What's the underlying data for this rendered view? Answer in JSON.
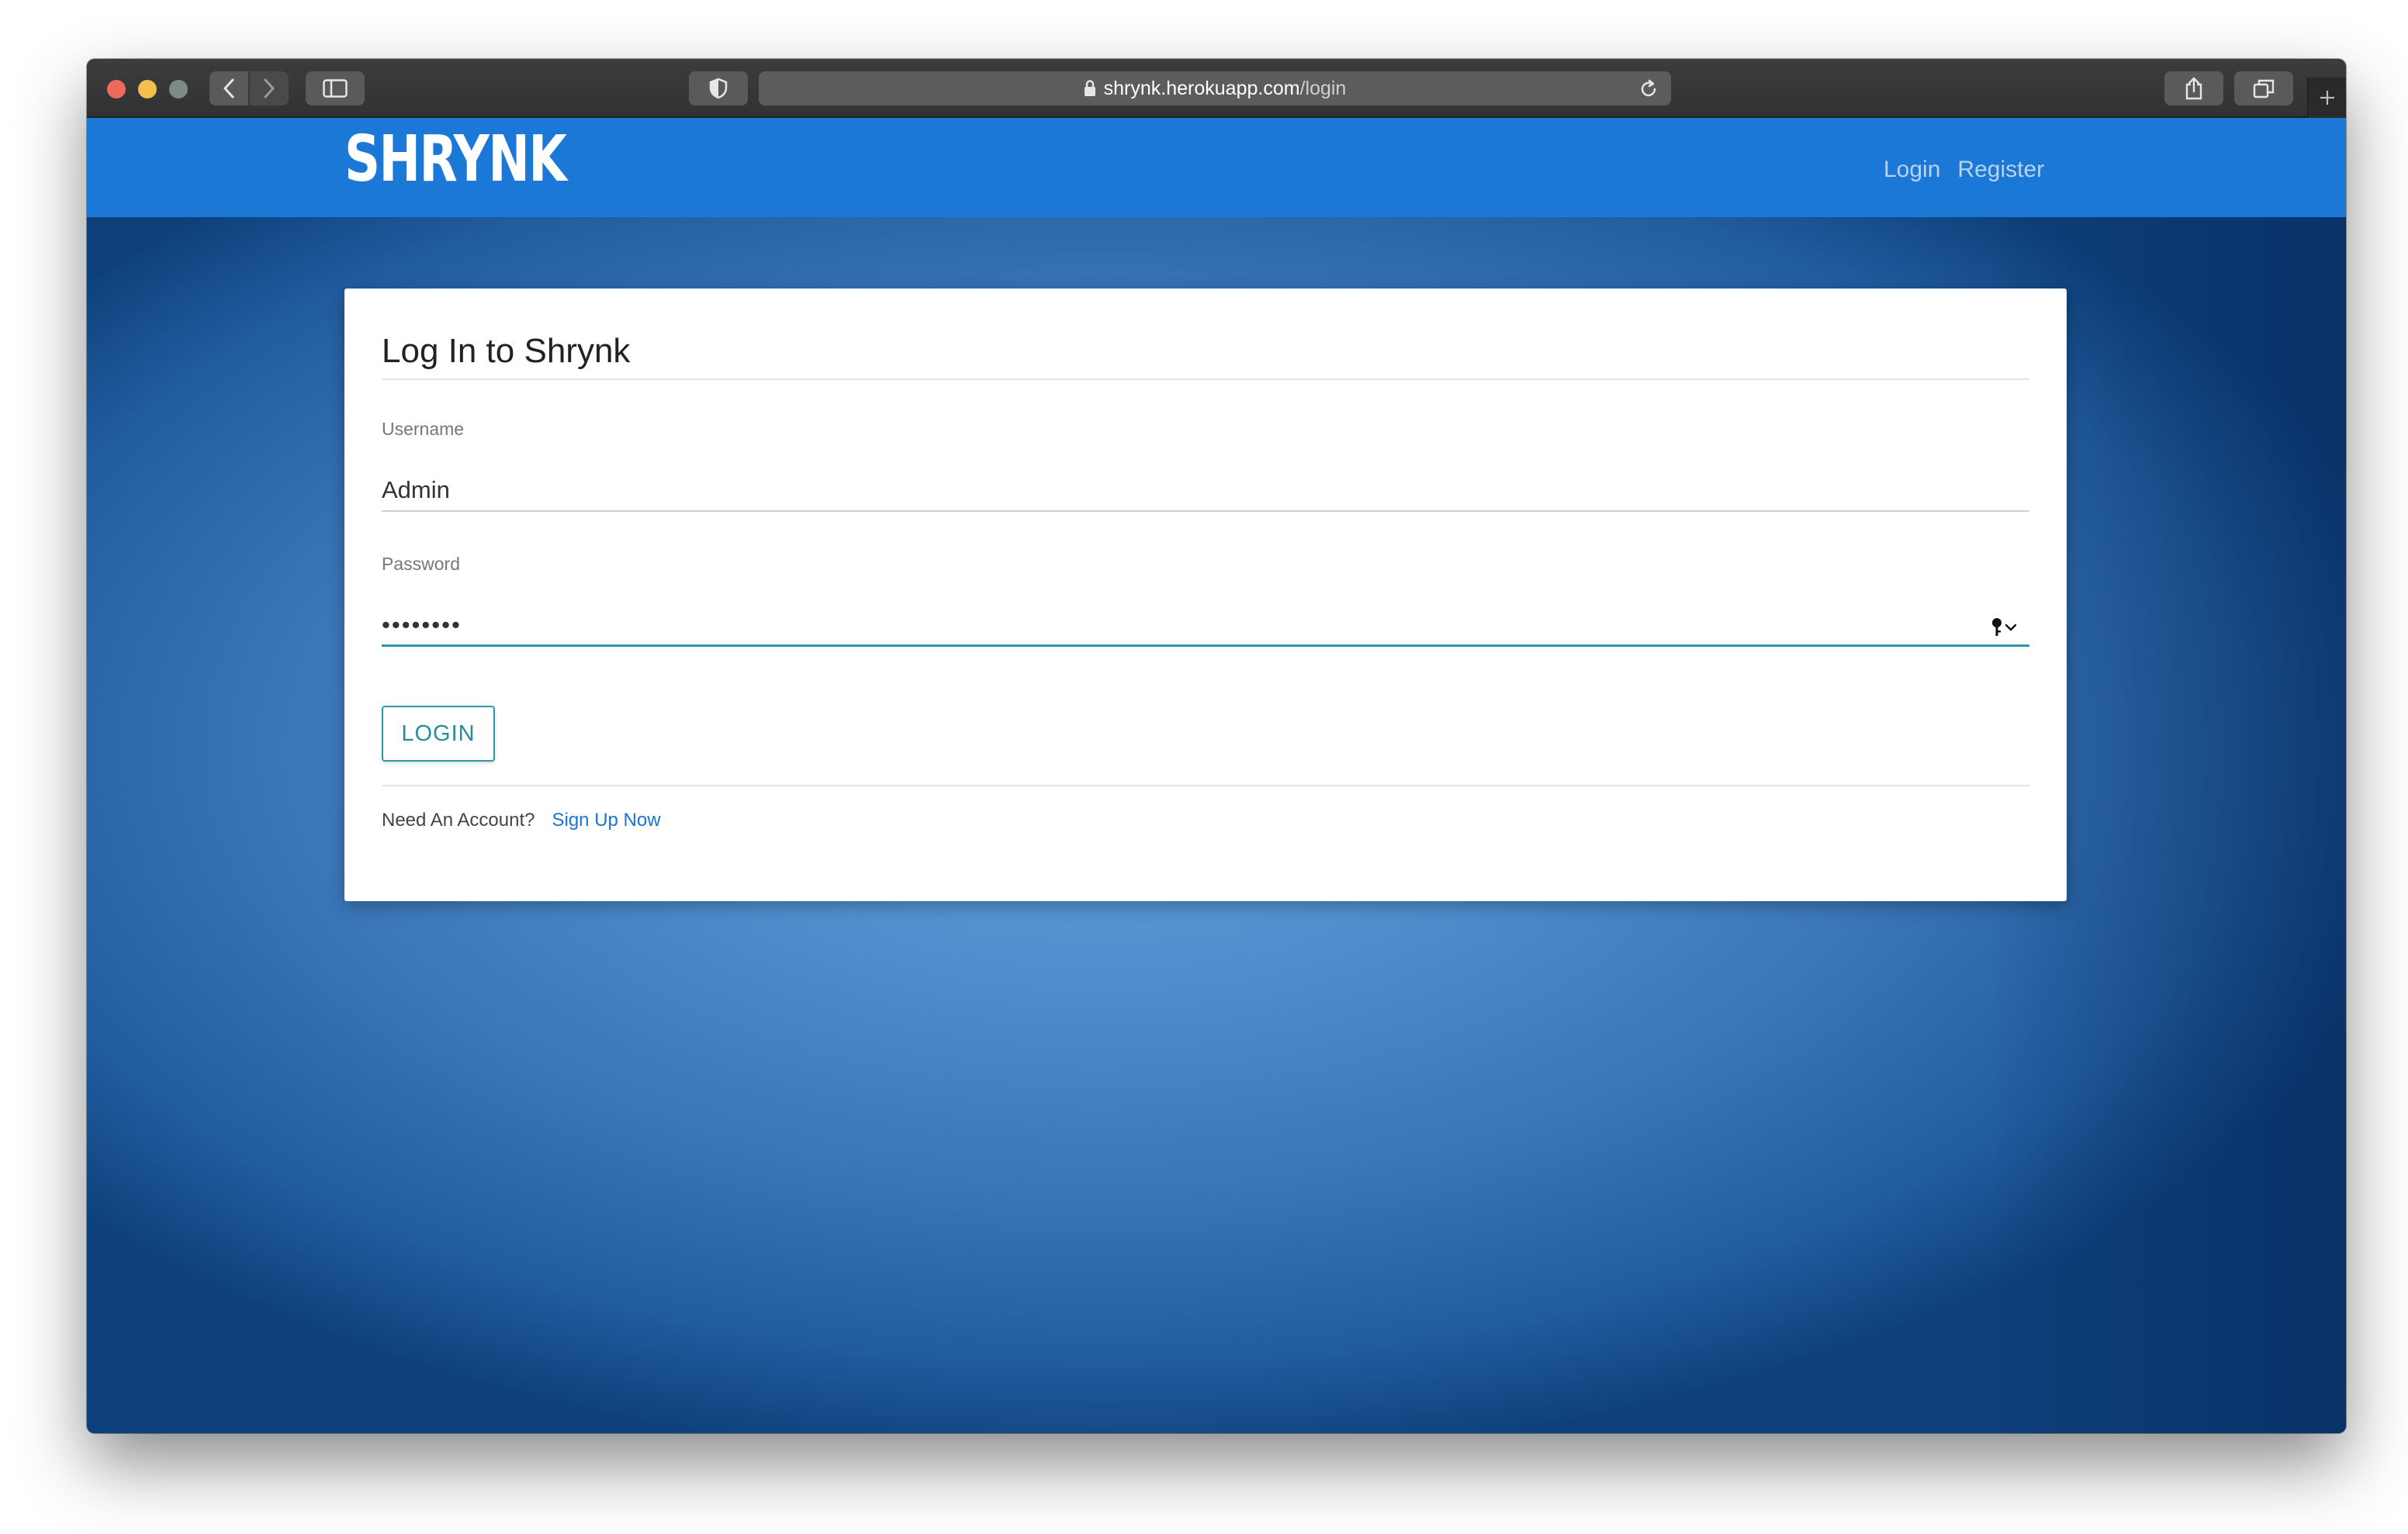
{
  "browser": {
    "url_host": "shrynk.herokuapp.com",
    "url_path": "/login"
  },
  "site": {
    "brand": "SHRYNK",
    "nav": {
      "login": "Login",
      "register": "Register"
    }
  },
  "login_form": {
    "title": "Log In to Shrynk",
    "username_label": "Username",
    "username_value": "Admin",
    "password_label": "Password",
    "password_value": "••••••••",
    "submit_label": "LOGIN",
    "footer_text": "Need An Account?",
    "signup_link": "Sign Up Now"
  },
  "colors": {
    "navbar": "#1b78d6",
    "accent": "#2a9aa7",
    "link": "#1a74d2"
  }
}
